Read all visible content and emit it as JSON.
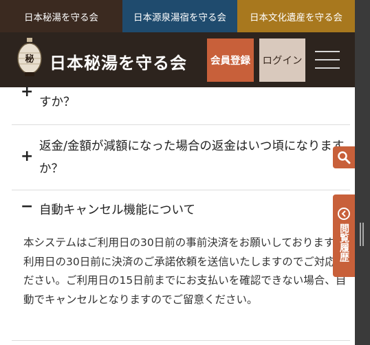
{
  "top_tabs": [
    "日本秘湯を守る会",
    "日本源泉湯宿を守る会",
    "日本文化遺産を守る会"
  ],
  "header": {
    "brand": "日本秘湯を守る会",
    "register": "会員登録",
    "login": "ログイン"
  },
  "faq": {
    "items": [
      {
        "question_tail": "すか？",
        "expanded": false
      },
      {
        "question": "返金/金額が減額になった場合の返金はいつ頃になりますか？",
        "expanded": false
      },
      {
        "question": "自動キャンセル機能について",
        "expanded": true,
        "answer": "本システムはご利用日の30日前の事前決済をお願いしております。利用日の30日前に決済のご承諾依頼を送信いたしますのでご対応ください。ご利用日の15日前までにお支払いを確認できない場合、自動でキャンセルとなりますのでご留意ください。"
      }
    ]
  },
  "side": {
    "history": "閲覧履歴"
  },
  "colors": {
    "accent": "#c8603a",
    "header": "#2d241e"
  }
}
